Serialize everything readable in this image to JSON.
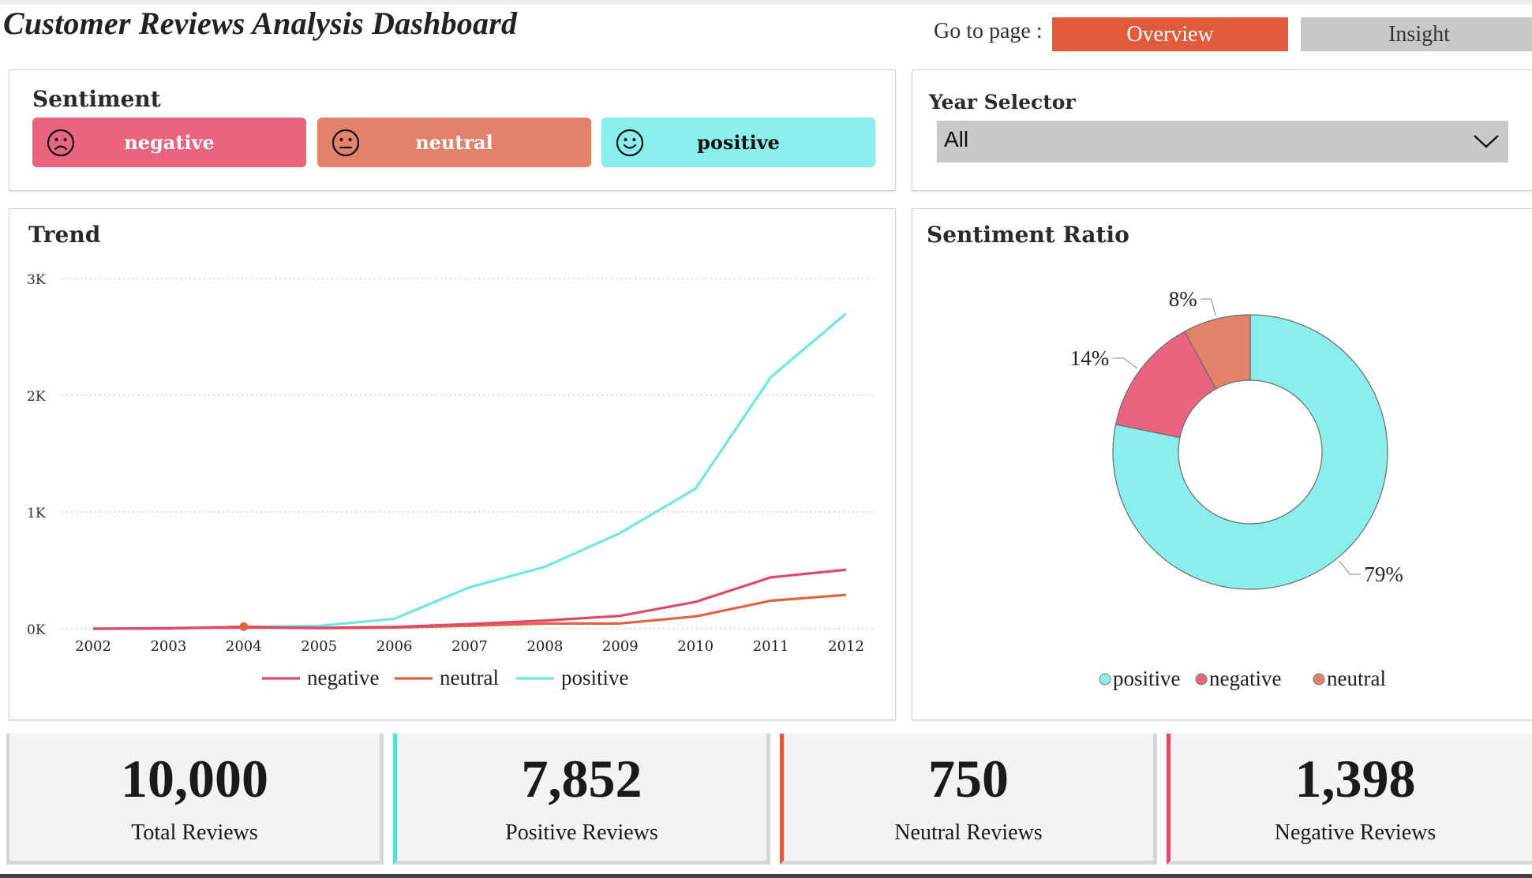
{
  "header": {
    "title": "Customer Reviews Analysis Dashboard",
    "goto_label": "Go to page :",
    "nav": [
      {
        "label": "Overview",
        "active": true
      },
      {
        "label": "Insight",
        "active": false
      }
    ]
  },
  "colors": {
    "negative": "#e8647f",
    "neutral": "#e3826a",
    "positive": "#8aeeec",
    "line_negative": "#e04a6a",
    "line_neutral": "#e0643f",
    "line_positive": "#6ee8e6",
    "nav_active": "#e25a3c"
  },
  "sentiment_filter": {
    "title": "Sentiment",
    "buttons": [
      {
        "label": "negative",
        "icon": "sad-face-icon"
      },
      {
        "label": "neutral",
        "icon": "neutral-face-icon"
      },
      {
        "label": "positive",
        "icon": "happy-face-icon"
      }
    ]
  },
  "year_selector": {
    "title": "Year Selector",
    "value": "All"
  },
  "trend": {
    "title": "Trend",
    "legend": [
      "negative",
      "neutral",
      "positive"
    ]
  },
  "ratio": {
    "title": "Sentiment Ratio",
    "legend": [
      "positive",
      "negative",
      "neutral"
    ]
  },
  "kpis": [
    {
      "value": "10,000",
      "label": "Total Reviews"
    },
    {
      "value": "7,852",
      "label": "Positive Reviews"
    },
    {
      "value": "750",
      "label": "Neutral Reviews"
    },
    {
      "value": "1,398",
      "label": "Negative Reviews"
    }
  ],
  "chart_data": [
    {
      "type": "line",
      "title": "Trend",
      "x": [
        2002,
        2003,
        2004,
        2005,
        2006,
        2007,
        2008,
        2009,
        2010,
        2011,
        2012
      ],
      "yticks": [
        "0K",
        "1K",
        "2K",
        "3K"
      ],
      "ylim": [
        0,
        3000
      ],
      "grid": true,
      "legend_position": "bottom",
      "series": [
        {
          "name": "negative",
          "values": [
            0,
            5,
            10,
            8,
            15,
            40,
            70,
            110,
            230,
            440,
            505
          ]
        },
        {
          "name": "neutral",
          "values": [
            0,
            2,
            18,
            4,
            10,
            25,
            45,
            45,
            105,
            240,
            290
          ]
        },
        {
          "name": "positive",
          "values": [
            0,
            5,
            15,
            25,
            85,
            355,
            530,
            820,
            1200,
            2155,
            2700
          ]
        }
      ]
    },
    {
      "type": "pie",
      "title": "Sentiment Ratio",
      "donut": true,
      "legend_position": "bottom",
      "categories": [
        "positive",
        "negative",
        "neutral"
      ],
      "values": [
        79,
        14,
        8
      ],
      "labels": [
        "79%",
        "14%",
        "8%"
      ]
    }
  ]
}
